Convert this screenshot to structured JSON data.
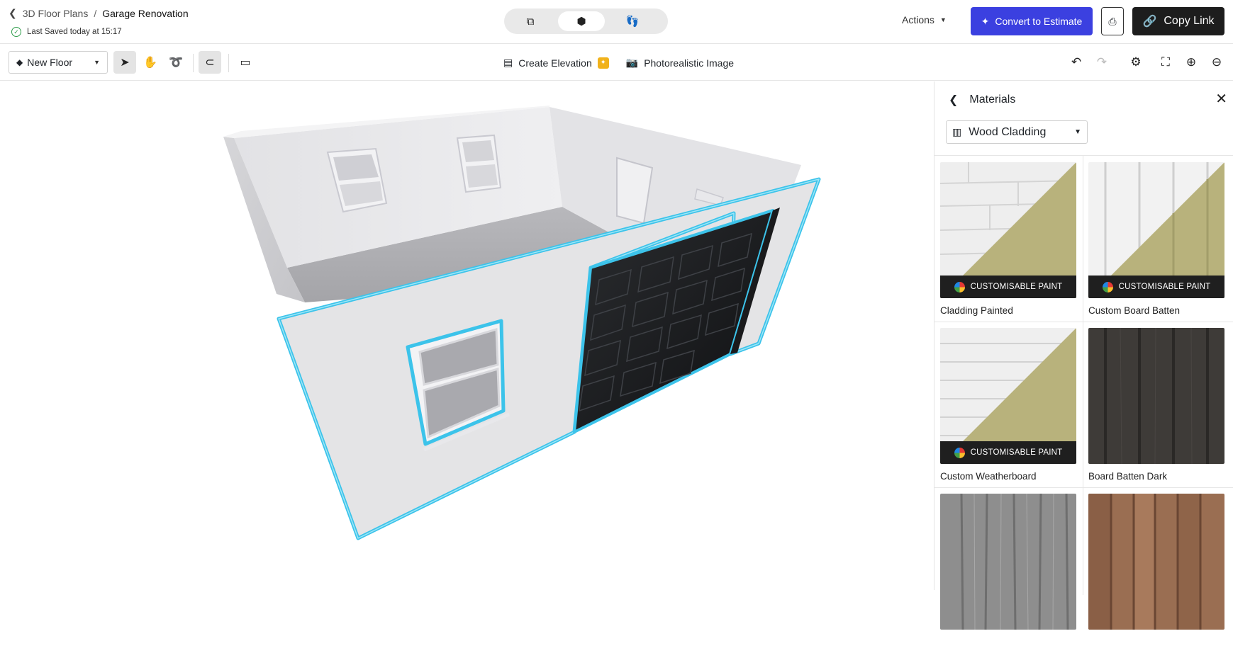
{
  "header": {
    "breadcrumb_parent": "3D Floor Plans",
    "breadcrumb_sep": "/",
    "title": "Garage Renovation",
    "saved_status": "Last Saved today at 15:17",
    "actions_label": "Actions",
    "estimate_label": "Convert to Estimate",
    "copy_label": "Copy Link"
  },
  "toolbar": {
    "floor_label": "New Floor",
    "elevation_label": "Create Elevation",
    "photo_label": "Photorealistic Image"
  },
  "panel": {
    "title": "Materials",
    "category": "Wood Cladding",
    "badge_label": "CUSTOMISABLE PAINT",
    "items": [
      {
        "name": "Cladding Painted",
        "customisable": true
      },
      {
        "name": "Custom Board Batten",
        "customisable": true
      },
      {
        "name": "Custom Weatherboard",
        "customisable": true
      },
      {
        "name": "Board Batten Dark",
        "customisable": false
      },
      {
        "name": "",
        "customisable": false
      },
      {
        "name": "",
        "customisable": false
      }
    ]
  },
  "colors": {
    "accent": "#3b40e0",
    "selection": "#3cc3ea",
    "paint_tint": "#b8b27c"
  }
}
